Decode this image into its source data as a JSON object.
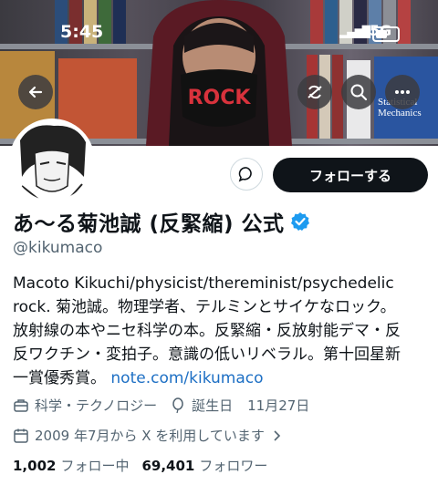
{
  "status_bar": {
    "time": "5:45",
    "network": "5G"
  },
  "header": {
    "back_icon": "arrow-left-icon",
    "actions": [
      "refresh-icon",
      "search-icon",
      "more-icon"
    ],
    "banner_text": [
      "ROCK",
      "Statistical",
      "Mechanics"
    ]
  },
  "profile": {
    "display_name": "あ〜る菊池誠 (反緊縮) 公式",
    "handle": "@kikumaco",
    "verified": true,
    "message_icon": "message-icon",
    "follow_label": "フォローする",
    "bio_lines": [
      "Macoto Kikuchi/physicist/thereminist/psychedelic",
      "rock. 菊池誠。物理学者、テルミンとサイケなロック。",
      "放射線の本やニセ科学の本。反緊縮・反放射能デマ・反",
      "反ワクチン・変拍子。意識の低いリベラル。第十回星新"
    ],
    "bio_last_line": "一賞優秀賞。",
    "bio_link": "note.com/kikumaco",
    "category": "科学・テクノロジー",
    "birthday_label": "誕生日",
    "birthday_value": "11月27日",
    "joined": "2009 年7月から X を利用しています",
    "following_count": "1,002",
    "following_label": "フォロー中",
    "followers_count": "69,401",
    "followers_label": "フォロワー",
    "colors": {
      "accent": "#1d9bf0",
      "link": "#1d6fc4",
      "muted": "#536471",
      "primary": "#0f1419"
    }
  }
}
